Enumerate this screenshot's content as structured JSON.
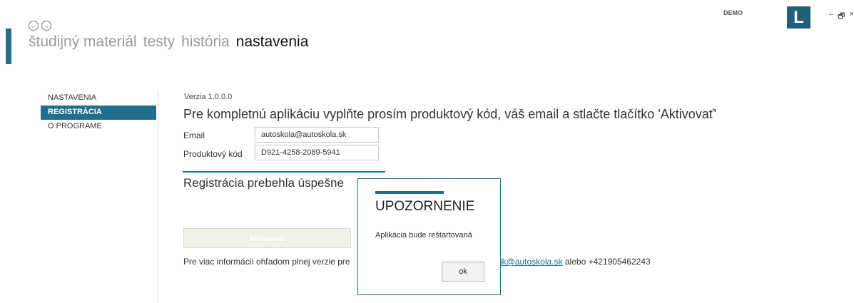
{
  "header": {
    "nav_back_icon": "←",
    "nav_forward_icon": "→",
    "menu": [
      {
        "label": "študijný materiál",
        "active": false
      },
      {
        "label": "testy",
        "active": false
      },
      {
        "label": "história",
        "active": false
      },
      {
        "label": "nastavenia",
        "active": true
      }
    ],
    "demo": "DEMO",
    "logo": "L",
    "window_controls": {
      "minimize": "–",
      "restore": "🗗",
      "close": "×"
    }
  },
  "sidebar": {
    "items": [
      {
        "label": "NASTAVENIA",
        "active": false
      },
      {
        "label": "REGISTRÁCIA",
        "active": true
      },
      {
        "label": "O PROGRAME",
        "active": false
      }
    ]
  },
  "content": {
    "version": "Verzia 1.0.0.0",
    "headline": "Pre kompletnú aplikáciu vyplňte  prosím produktový kód, váš email a stlačte tlačítko 'Aktivovať'",
    "email_label": "Email",
    "email_value": "autoskola@autoskola.sk",
    "code_label": "Produktový kód",
    "code_value": "D921-4258-2089-5941",
    "success_text": "Registrácia prebehla úspešne",
    "activate_button": "Aktivovať",
    "info_text": "Pre viac informácií ohľadom plnej verzie pre",
    "info_link": "urik@autoskola.sk",
    "info_suffix": " alebo +421905462243"
  },
  "dialog": {
    "title": "UPOZORNENIE",
    "message": "Aplikácia bude reštartovaná",
    "ok_button": "ok"
  },
  "colors": {
    "accent": "#1f6e8c",
    "logo": "#1f5f7a"
  }
}
